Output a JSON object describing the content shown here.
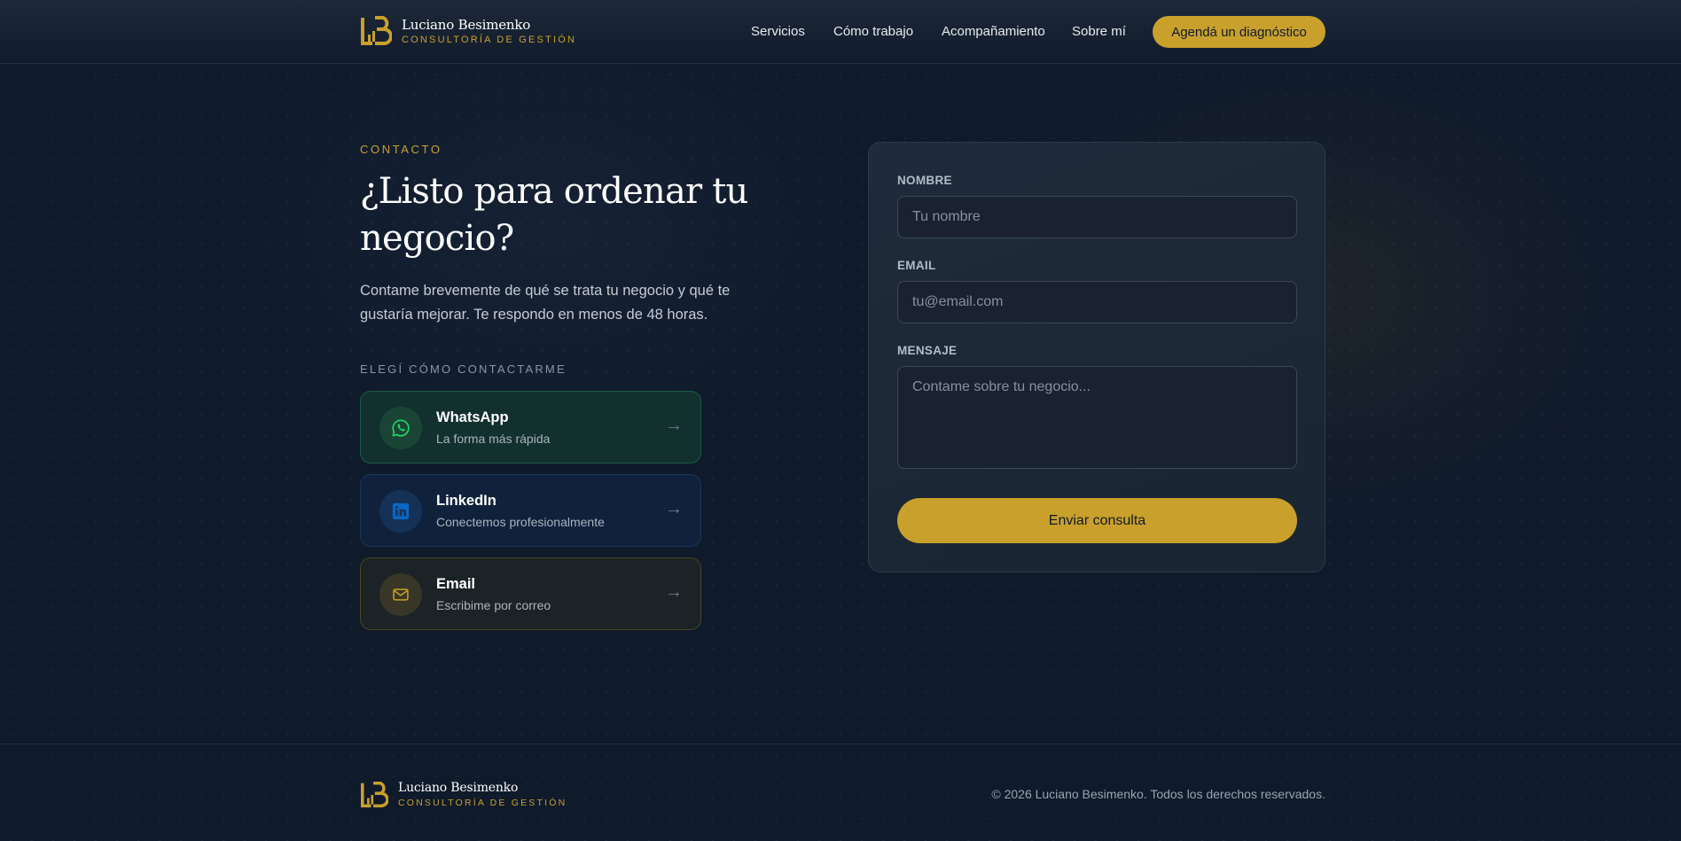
{
  "brand": {
    "name": "Luciano Besimenko",
    "subtitle": "CONSULTORÍA DE GESTIÓN"
  },
  "nav": {
    "items": [
      {
        "label": "Servicios"
      },
      {
        "label": "Cómo trabajo"
      },
      {
        "label": "Acompañamiento"
      },
      {
        "label": "Sobre mí"
      }
    ],
    "cta_label": "Agendá un diagnóstico"
  },
  "contact": {
    "eyebrow": "CONTACTO",
    "headline": "¿Listo para ordenar tu negocio?",
    "intro": "Contame brevemente de qué se trata tu negocio y qué te gustaría mejorar. Te respondo en menos de 48 horas.",
    "choose_label": "ELEGÍ CÓMO CONTACTARME",
    "options": [
      {
        "title": "WhatsApp",
        "subtitle": "La forma más rápida",
        "icon": "whatsapp-icon",
        "arrow": "→"
      },
      {
        "title": "LinkedIn",
        "subtitle": "Conectemos profesionalmente",
        "icon": "linkedin-icon",
        "arrow": "→"
      },
      {
        "title": "Email",
        "subtitle": "Escribime por correo",
        "icon": "mail-icon",
        "arrow": "→"
      }
    ]
  },
  "form": {
    "name_label": "NOMBRE",
    "name_placeholder": "Tu nombre",
    "email_label": "EMAIL",
    "email_placeholder": "tu@email.com",
    "message_label": "MENSAJE",
    "message_placeholder": "Contame sobre tu negocio...",
    "submit_label": "Enviar consulta"
  },
  "footer": {
    "copyright": "© 2026 Luciano Besimenko. Todos los derechos reservados."
  },
  "colors": {
    "accent": "#c9a02c",
    "background": "#0f1a2b",
    "whatsapp": "#25d366",
    "linkedin": "#0a66c2"
  }
}
